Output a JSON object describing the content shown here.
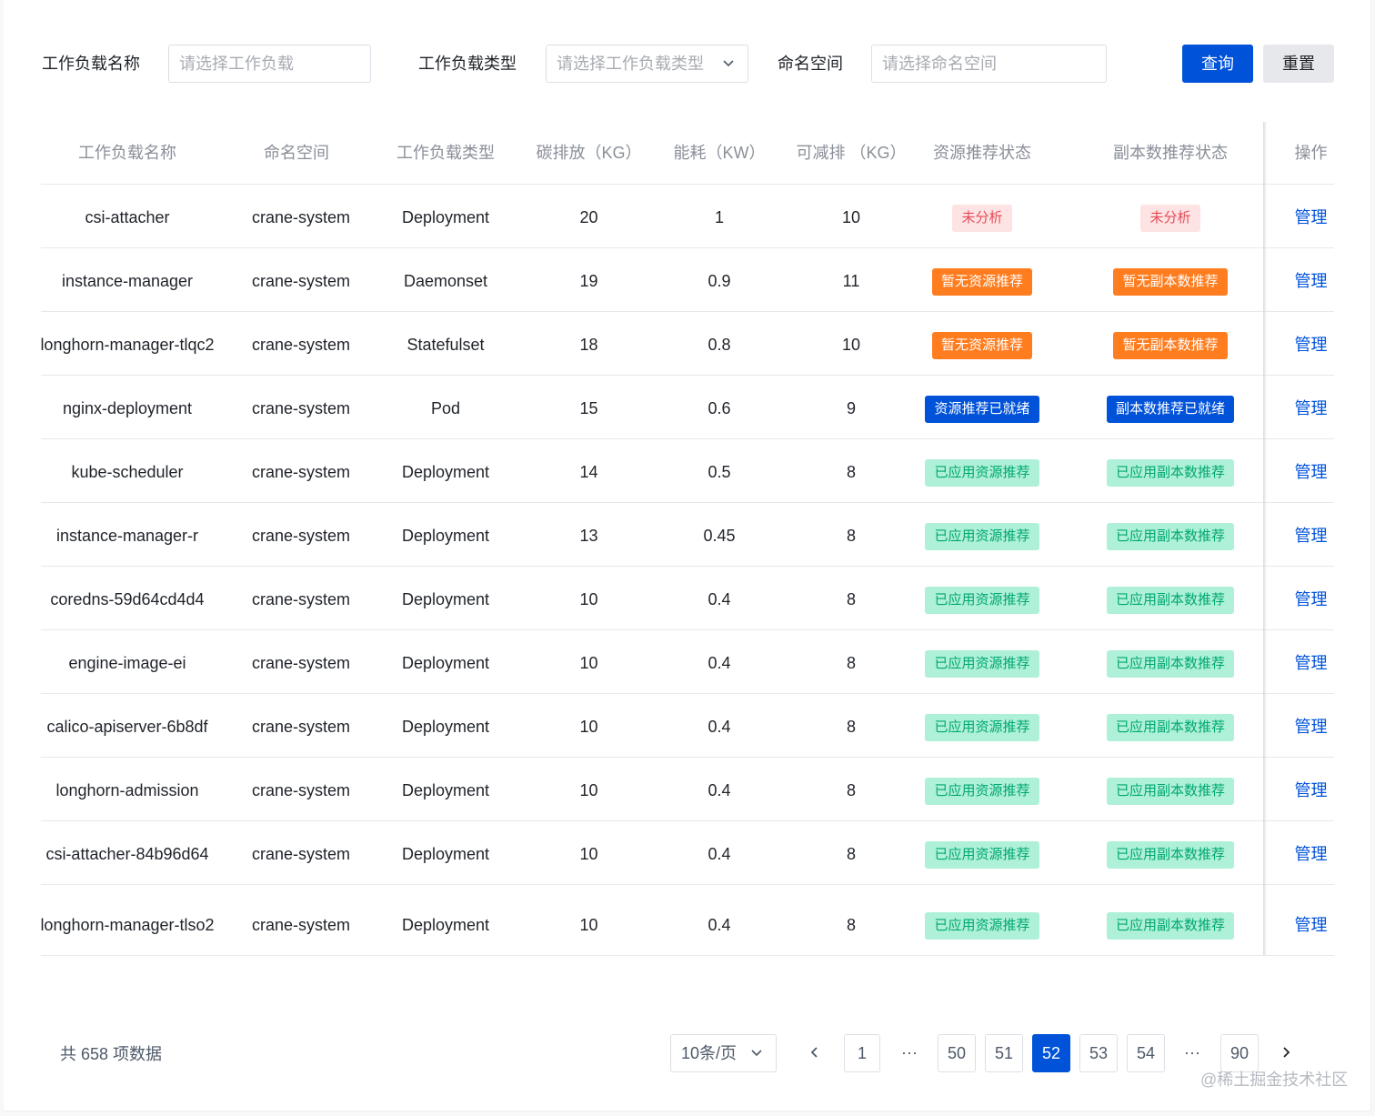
{
  "filters": {
    "workload_name_label": "工作负载名称",
    "workload_name_placeholder": "请选择工作负载",
    "workload_type_label": "工作负载类型",
    "workload_type_placeholder": "请选择工作负载类型",
    "namespace_label": "命名空间",
    "namespace_placeholder": "请选择命名空间",
    "query_button": "查询",
    "reset_button": "重置"
  },
  "table": {
    "columns": [
      "工作负载名称",
      "命名空间",
      "工作负载类型",
      "碳排放（KG）",
      "能耗（KW）",
      "可减排 （KG）",
      "资源推荐状态",
      "副本数推荐状态",
      "操作"
    ],
    "rows": [
      {
        "name": "csi-attacher",
        "namespace": "crane-system",
        "type": "Deployment",
        "carbon": "20",
        "energy": "1",
        "reducible": "10",
        "res_status": "未分析",
        "res_kind": "gray",
        "rep_status": "未分析",
        "rep_kind": "gray",
        "action": "管理"
      },
      {
        "name": "instance-manager",
        "namespace": "crane-system",
        "type": "Daemonset",
        "carbon": "19",
        "energy": "0.9",
        "reducible": "11",
        "res_status": "暂无资源推荐",
        "res_kind": "orange",
        "rep_status": "暂无副本数推荐",
        "rep_kind": "orange",
        "action": "管理"
      },
      {
        "name": "longhorn-manager-tlqc2",
        "namespace": "crane-system",
        "type": "Statefulset",
        "carbon": "18",
        "energy": "0.8",
        "reducible": "10",
        "res_status": "暂无资源推荐",
        "res_kind": "orange",
        "rep_status": "暂无副本数推荐",
        "rep_kind": "orange",
        "action": "管理"
      },
      {
        "name": "nginx-deployment",
        "namespace": "crane-system",
        "type": "Pod",
        "carbon": "15",
        "energy": "0.6",
        "reducible": "9",
        "res_status": "资源推荐已就绪",
        "res_kind": "blue",
        "rep_status": "副本数推荐已就绪",
        "rep_kind": "blue",
        "action": "管理"
      },
      {
        "name": "kube-scheduler",
        "namespace": "crane-system",
        "type": "Deployment",
        "carbon": "14",
        "energy": "0.5",
        "reducible": "8",
        "res_status": "已应用资源推荐",
        "res_kind": "green",
        "rep_status": "已应用副本数推荐",
        "rep_kind": "green",
        "action": "管理"
      },
      {
        "name": "instance-manager-r",
        "namespace": "crane-system",
        "type": "Deployment",
        "carbon": "13",
        "energy": "0.45",
        "reducible": "8",
        "res_status": "已应用资源推荐",
        "res_kind": "green",
        "rep_status": "已应用副本数推荐",
        "rep_kind": "green",
        "action": "管理"
      },
      {
        "name": "coredns-59d64cd4d4",
        "namespace": "crane-system",
        "type": "Deployment",
        "carbon": "10",
        "energy": "0.4",
        "reducible": "8",
        "res_status": "已应用资源推荐",
        "res_kind": "green",
        "rep_status": "已应用副本数推荐",
        "rep_kind": "green",
        "action": "管理"
      },
      {
        "name": "engine-image-ei",
        "namespace": "crane-system",
        "type": "Deployment",
        "carbon": "10",
        "energy": "0.4",
        "reducible": "8",
        "res_status": "已应用资源推荐",
        "res_kind": "green",
        "rep_status": "已应用副本数推荐",
        "rep_kind": "green",
        "action": "管理"
      },
      {
        "name": "calico-apiserver-6b8df",
        "namespace": "crane-system",
        "type": "Deployment",
        "carbon": "10",
        "energy": "0.4",
        "reducible": "8",
        "res_status": "已应用资源推荐",
        "res_kind": "green",
        "rep_status": "已应用副本数推荐",
        "rep_kind": "green",
        "action": "管理"
      },
      {
        "name": "longhorn-admission",
        "namespace": "crane-system",
        "type": "Deployment",
        "carbon": "10",
        "energy": "0.4",
        "reducible": "8",
        "res_status": "已应用资源推荐",
        "res_kind": "green",
        "rep_status": "已应用副本数推荐",
        "rep_kind": "green",
        "action": "管理"
      },
      {
        "name": "csi-attacher-84b96d64",
        "namespace": "crane-system",
        "type": "Deployment",
        "carbon": "10",
        "energy": "0.4",
        "reducible": "8",
        "res_status": "已应用资源推荐",
        "res_kind": "green",
        "rep_status": "已应用副本数推荐",
        "rep_kind": "green",
        "action": "管理"
      },
      {
        "name": "longhorn-manager-tlso2",
        "namespace": "crane-system",
        "type": "Deployment",
        "carbon": "10",
        "energy": "0.4",
        "reducible": "8",
        "res_status": "已应用资源推荐",
        "res_kind": "green",
        "rep_status": "已应用副本数推荐",
        "rep_kind": "green",
        "action": "管理"
      }
    ]
  },
  "pagination": {
    "total": "共 658 项数据",
    "page_size": "10条/页",
    "prev": "‹",
    "next": "›",
    "ellipsis": "···",
    "pages": [
      "1",
      "50",
      "51",
      "52",
      "53",
      "54",
      "90"
    ],
    "current": "52"
  },
  "watermark": "@稀土掘金技术社区",
  "colors": {
    "primary": "#0052d9",
    "orange": "#ff7d1f",
    "green_bg": "#aef0d8",
    "green_text": "#00a870",
    "gray_bg": "#fde3e3",
    "gray_text": "#e34d59"
  }
}
